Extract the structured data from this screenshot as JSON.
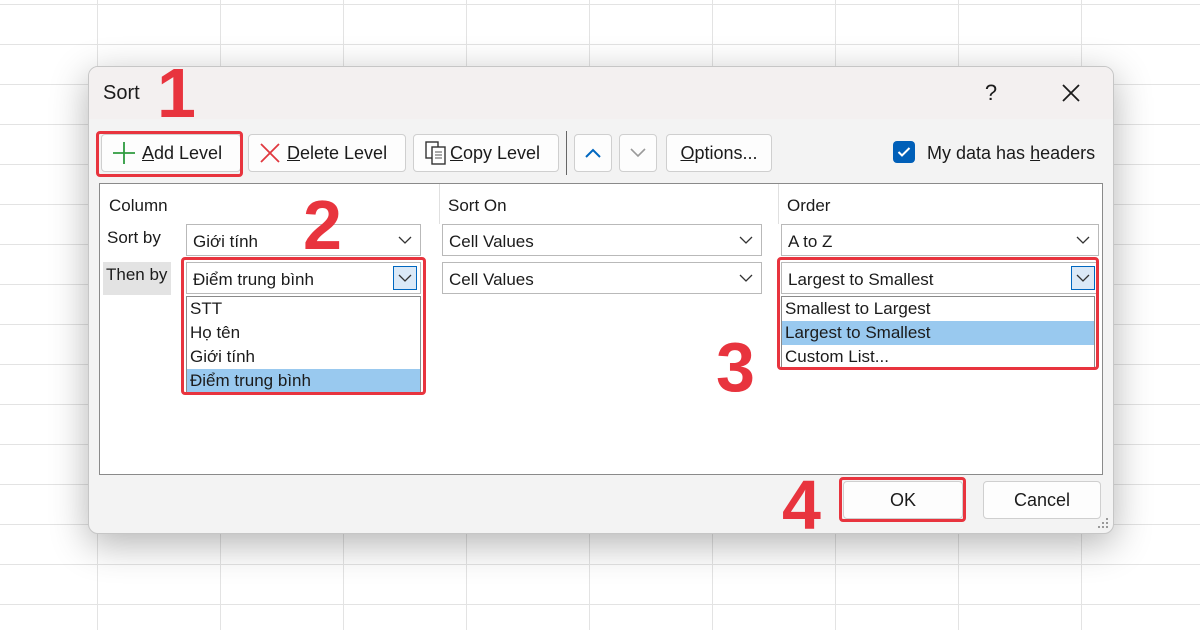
{
  "dialog": {
    "title": "Sort",
    "help_label": "?",
    "close_label": "✕"
  },
  "toolbar": {
    "add_level": {
      "first": "A",
      "rest": "dd Level"
    },
    "delete_level": {
      "first": "D",
      "rest": "elete Level"
    },
    "copy_level": {
      "first": "C",
      "rest": "opy Level"
    },
    "options": {
      "first": "O",
      "rest": "ptions..."
    },
    "headers_checkbox": {
      "before": "My data has ",
      "underline": "h",
      "after": "eaders",
      "checked": true
    }
  },
  "columns": {
    "column": "Column",
    "sort_on": "Sort On",
    "order": "Order"
  },
  "rows": [
    {
      "label": "Sort by",
      "column": "Giới tính",
      "sort_on": "Cell Values",
      "order": "A to Z"
    },
    {
      "label": "Then by",
      "column": "Điểm trung bình",
      "sort_on": "Cell Values",
      "order": "Largest to Smallest"
    }
  ],
  "column_dropdown": {
    "options": [
      "STT",
      "Họ tên",
      "Giới tính",
      "Điểm trung bình"
    ],
    "selected_index": 3
  },
  "order_dropdown": {
    "options": [
      "Smallest to Largest",
      "Largest to Smallest",
      "Custom List..."
    ],
    "selected_index": 1
  },
  "footer": {
    "ok": "OK",
    "cancel": "Cancel"
  },
  "steps": [
    "1",
    "2",
    "3",
    "4"
  ],
  "colors": {
    "accent": "#005fb8",
    "highlight": "#e8343e",
    "selection": "#99c9ef",
    "add_icon": "#2e9b3f",
    "delete_icon": "#e0383f"
  }
}
